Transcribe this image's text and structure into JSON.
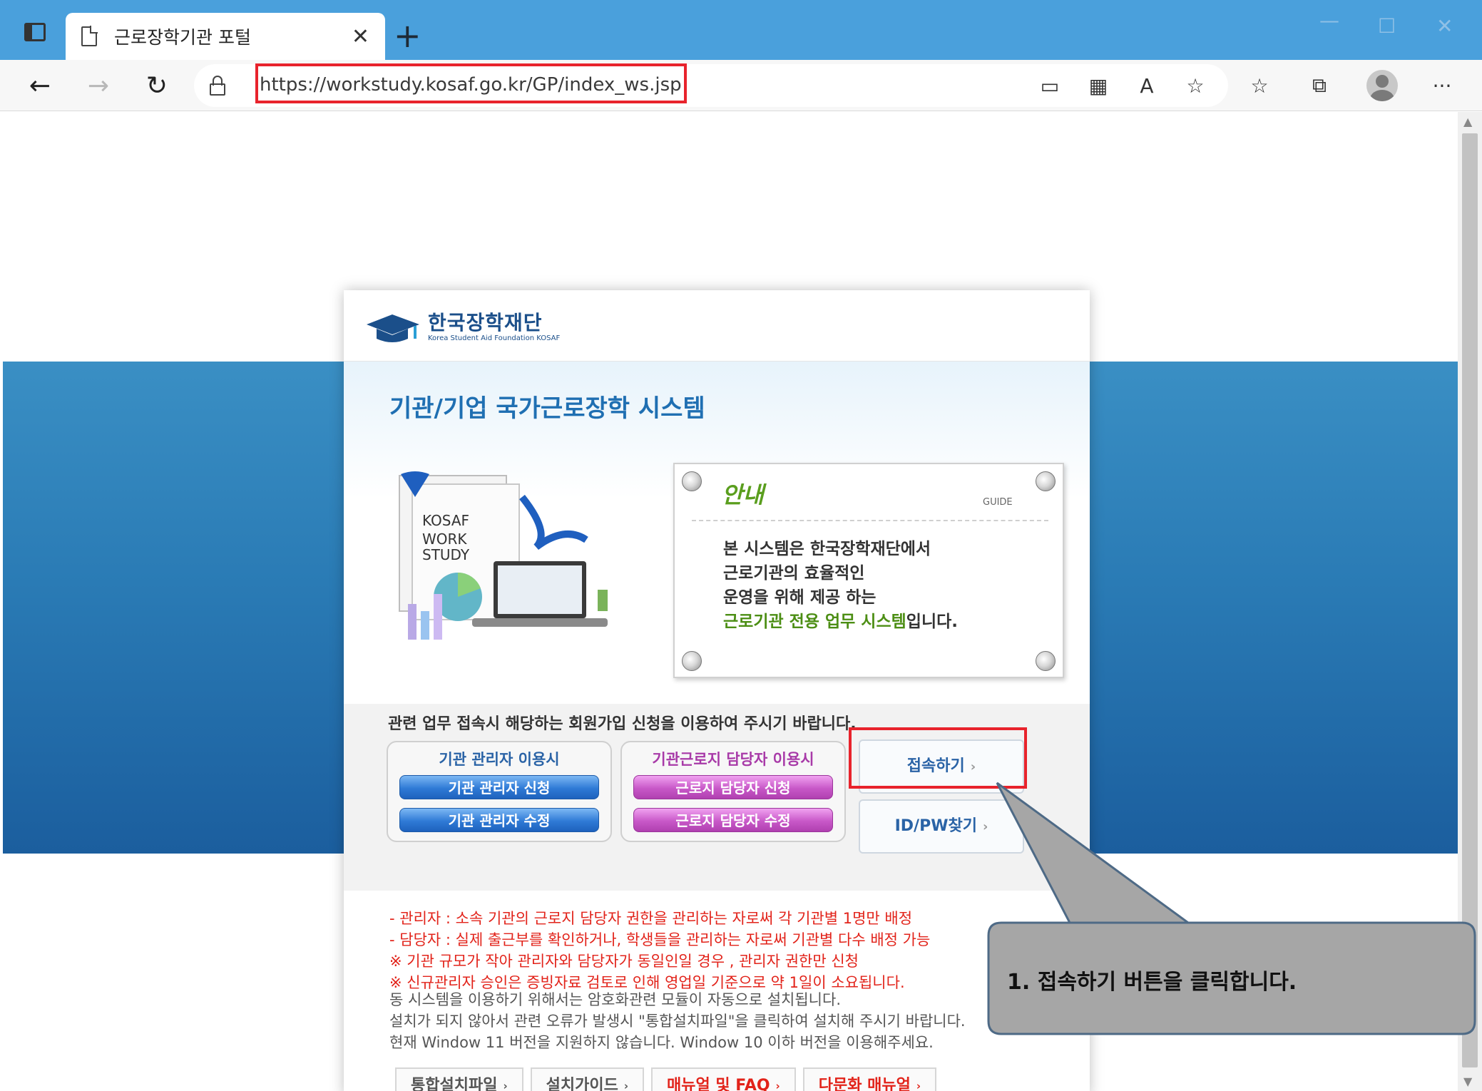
{
  "browser": {
    "tab_title": "근로장학기관 포털",
    "url": "https://workstudy.kosaf.go.kr/GP/index_ws.jsp"
  },
  "logo": {
    "name": "한국장학재단",
    "sub": "Korea Student Aid Foundation KOSAF"
  },
  "system_title": "기관/기업 국가근로장학 시스템",
  "illustration_text": [
    "KOSAF",
    "WORK",
    "STUDY"
  ],
  "guide": {
    "heading": "안내",
    "tag": "GUIDE",
    "lines": [
      "본 시스템은 한국장학재단에서",
      "근로기관의 효율적인",
      "운영을 위해 제공 하는"
    ],
    "highlight": "근로기관 전용 업무 시스템",
    "highlight_suffix": "입니다."
  },
  "notice_title": "관련 업무 접속시 해당하는 회원가입 신청을 이용하여 주시기 바랍니다.",
  "admin_group": {
    "title": "기관 관리자 이용시",
    "apply": "기관 관리자 신청",
    "modify": "기관 관리자 수정"
  },
  "worker_group": {
    "title": "기관근로지 담당자 이용시",
    "apply": "근로지 담당자 신청",
    "modify": "근로지 담당자 수정"
  },
  "connect_button": "접속하기",
  "findid_button": "ID/PW찾기",
  "red_notes": [
    "- 관리자 : 소속 기관의 근로지 담당자 권한을 관리하는 자로써 각 기관별 1명만 배정",
    "- 담당자 : 실제 출근부를 확인하거나, 학생들을 관리하는 자로써 기관별 다수 배정 가능",
    "※ 기관 규모가 작아 관리자와 담당자가 동일인일 경우 , 관리자 권한만 신청",
    "※ 신규관리자 승인은 증빙자료 검토로 인해 영업일 기준으로 약 1일이 소요됩니다."
  ],
  "gray_notes": [
    "동 시스템을 이용하기 위해서는 암호화관련 모듈이 자동으로 설치됩니다.",
    "설치가 되지 않아서 관련 오류가 발생시 \"통합설치파일\"을 클릭하여 설치해 주시기 바랍니다.",
    "현재 Window 11 버전을 지원하지 않습니다. Window 10 이하 버전을 이용해주세요."
  ],
  "bottom_links": [
    "통합설치파일",
    "설치가이드",
    "매뉴얼 및 FAQ",
    "다문화 매뉴얼"
  ],
  "callout": "1.  접속하기 버튼을 클릭합니다.",
  "colors": {
    "titlebar": "#4aa0dc",
    "highlight_border": "#e8232c",
    "brand_blue": "#1f6fb2",
    "guide_green": "#4c8e14",
    "note_red": "#e2231a"
  }
}
